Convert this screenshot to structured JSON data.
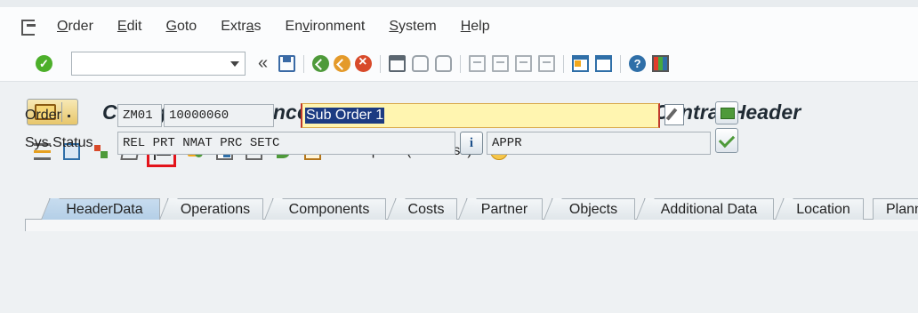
{
  "menu": {
    "items": [
      {
        "pre": "",
        "key": "O",
        "post": "rder"
      },
      {
        "pre": "",
        "key": "E",
        "post": "dit"
      },
      {
        "pre": "",
        "key": "G",
        "post": "oto"
      },
      {
        "pre": "Extr",
        "key": "a",
        "post": "s"
      },
      {
        "pre": "En",
        "key": "v",
        "post": "ironment"
      },
      {
        "pre": "",
        "key": "S",
        "post": "ystem"
      },
      {
        "pre": "",
        "key": "H",
        "post": "elp"
      }
    ]
  },
  "toolbar": {
    "command_value": "",
    "double_arrow": "«"
  },
  "title": {
    "text": "Change Maintenance/Service Order (Internal) 10000060: Central Header"
  },
  "app_toolbar": {
    "complete_label": "Complete (business)",
    "info_glyph": "i"
  },
  "header": {
    "order_label": "Order",
    "order_type": "ZM01",
    "order_number": "10000060",
    "description": "Sub Order 1",
    "sys_status_label": "Sys.Status",
    "sys_status": "REL  PRT  NMAT PRC  SETC",
    "info_button": "i",
    "user_status": "APPR"
  },
  "tabs": [
    "HeaderData",
    "Operations",
    "Components",
    "Costs",
    "Partner",
    "Objects",
    "Additional Data",
    "Location",
    "Planning"
  ],
  "active_tab": "HeaderData"
}
